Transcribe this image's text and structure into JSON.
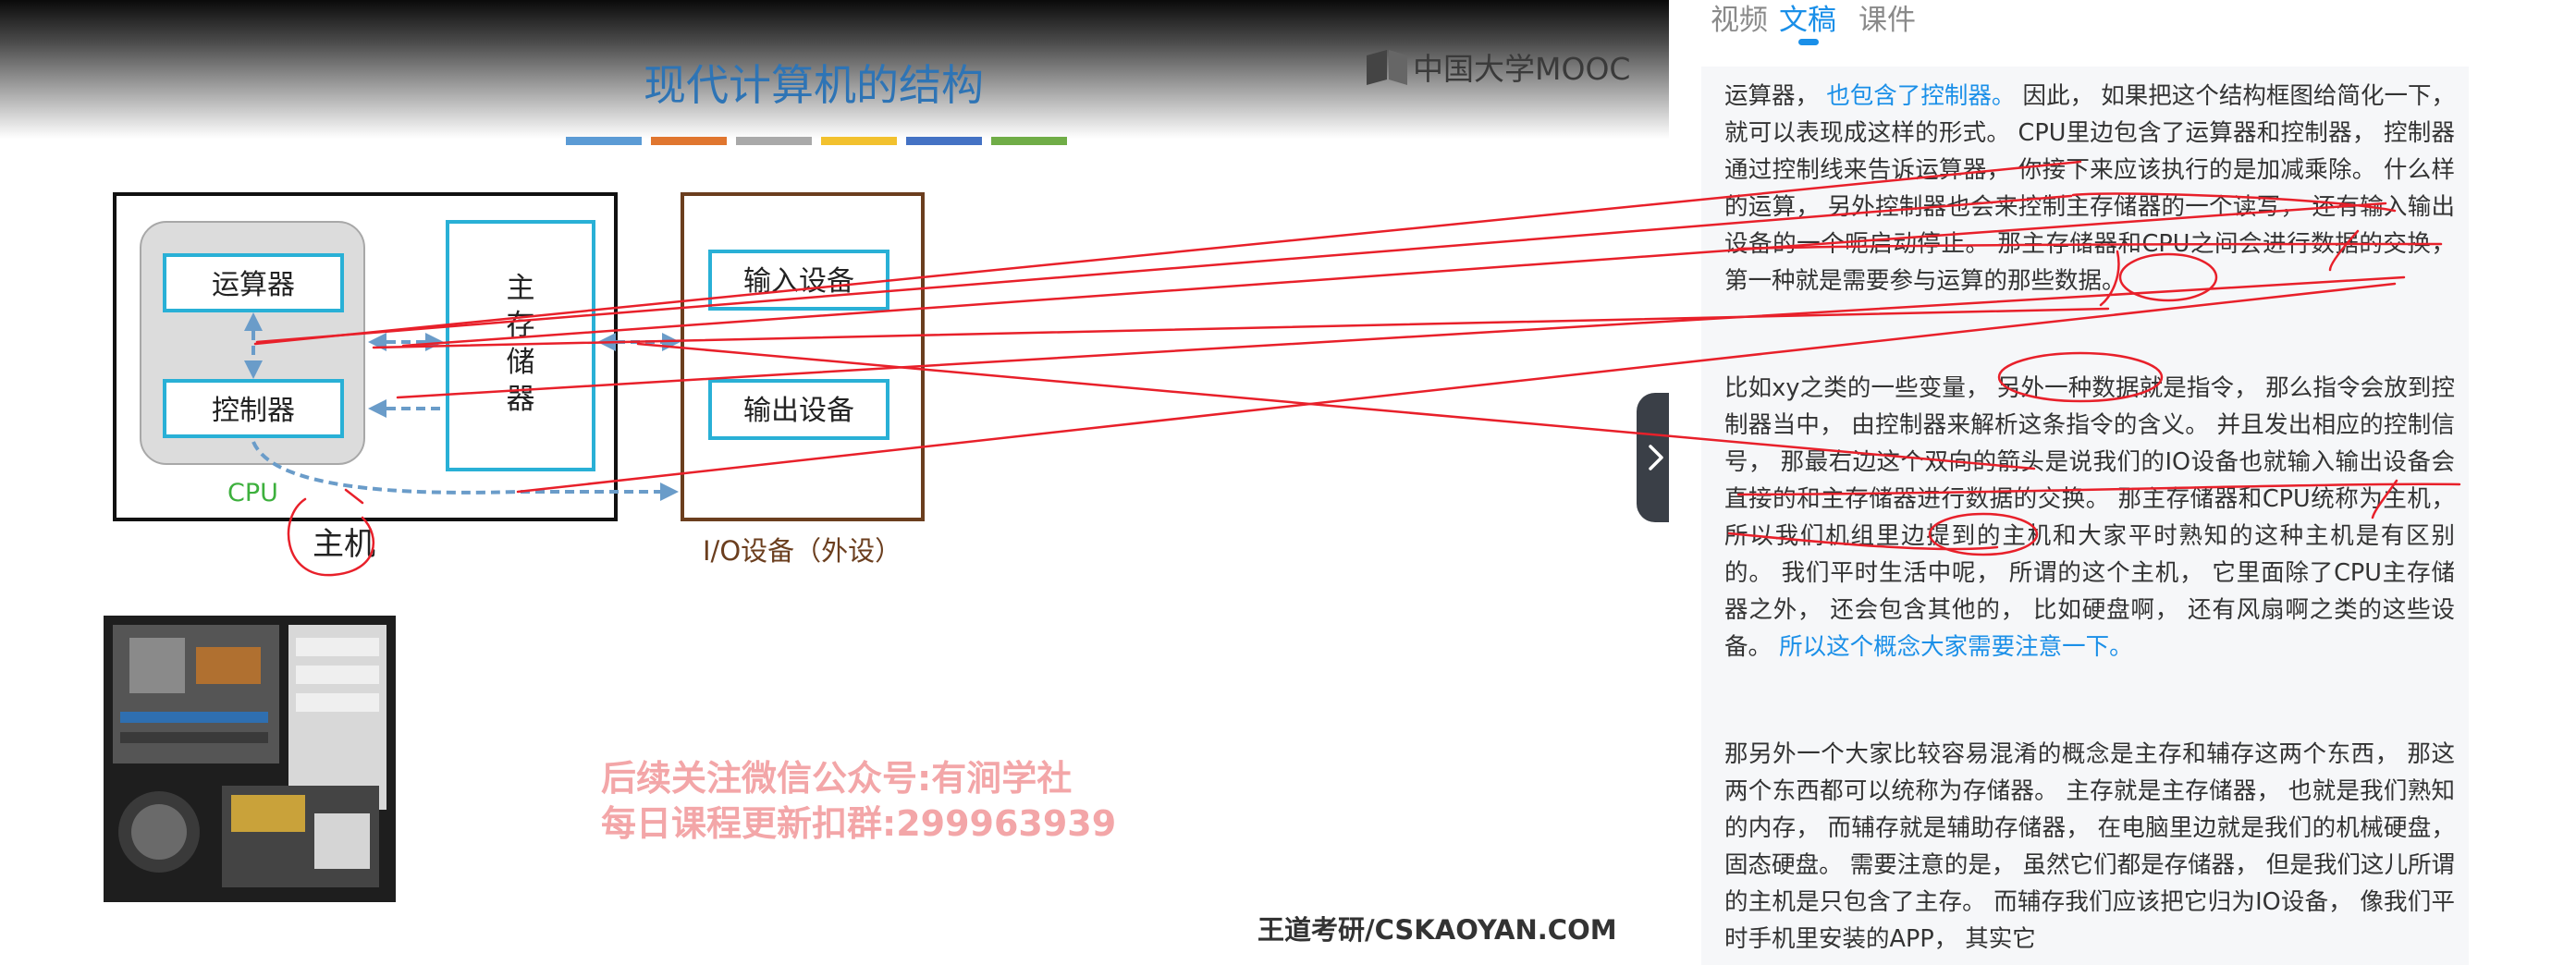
{
  "slide": {
    "title": "现代计算机的结构",
    "logo_text": "中国大学MOOC",
    "accent_colors": [
      "#5b9bd5",
      "#e0762f",
      "#a9a9a9",
      "#f2c12e",
      "#4472c4",
      "#70ad47"
    ],
    "blocks": {
      "alu": "运算器",
      "controller": "控制器",
      "main_memory": [
        "主",
        "存",
        "储",
        "器"
      ],
      "input_device": "输入设备",
      "output_device": "输出设备",
      "cpu_label": "CPU",
      "host_label": "主机",
      "io_label": "I/O设备（外设）"
    },
    "watermark_line1": "后续关注微信公众号:有涧学社",
    "watermark_line2": "每日课程更新扣群:299963939",
    "footer": "王道考研/CSKAOYAN.COM"
  },
  "tabs": [
    {
      "label": "视频"
    },
    {
      "label": "文稿"
    },
    {
      "label": "课件"
    }
  ],
  "active_tab": "文稿",
  "transcript": {
    "p1_a": "运算器，",
    "p1_hl": "也包含了控制器。",
    "p1_b": "因此， 如果把这个结构框图给简化一下， 就可以表现成这样的形式。 CPU里边包含了运算器和控制器， 控制器通过控制线来告诉运算器， 你接下来应该执行的是加减乘除。 什么样的运算， 另外控制器也会来控制主存储器的一个读写， 还有输入输出设备的一个呃启动停止。 那主存储器和CPU之间会进行数据的交换， 第一种就是需要参与运算的那些数据。",
    "p2_a": "比如xy之类的一些变量， 另外一种数据就是指令， 那么指令会放到控制器当中， 由控制器来解析这条指令的含义。 并且发出相应的控制信号， 那最右边这个双向的箭头是说我们的IO设备也就输入输出设备会直接的和主存储器进行数据的交换。 那主存储器和CPU统称为主机， 所以我们机组里边提到的主机和大家平时熟知的这种主机是有区别的。 我们平时生活中呢， 所谓的这个主机， 它里面除了CPU主存储器之外， 还会包含其他的， 比如硬盘啊， 还有风扇啊之类的这些设备。",
    "p2_hl": "所以这个概念大家需要注意一下。",
    "p3": "那另外一个大家比较容易混淆的概念是主存和辅存这两个东西， 那这两个东西都可以统称为存储器。 主存就是主存储器， 也就是我们熟知的内存， 而辅存就是辅助存储器， 在电脑里边就是我们的机械硬盘， 固态硬盘。 需要注意的是， 虽然它们都是存储器， 但是我们这儿所谓的主机是只包含了主存。 而辅存我们应该把它归为IO设备， 像我们平时手机里安装的APP， 其实它"
  },
  "icons": {
    "collapse": "chevron-right-icon",
    "logo": "mooc-logo-icon"
  },
  "colors": {
    "tab_active": "#1a8fe8",
    "highlight_text": "#1a8fe8",
    "annotation": "#e8202a",
    "block_border": "#29b0d6",
    "arrow": "#6a9cc9",
    "io_border": "#6b3e1e",
    "watermark": "#f3a6a8"
  }
}
